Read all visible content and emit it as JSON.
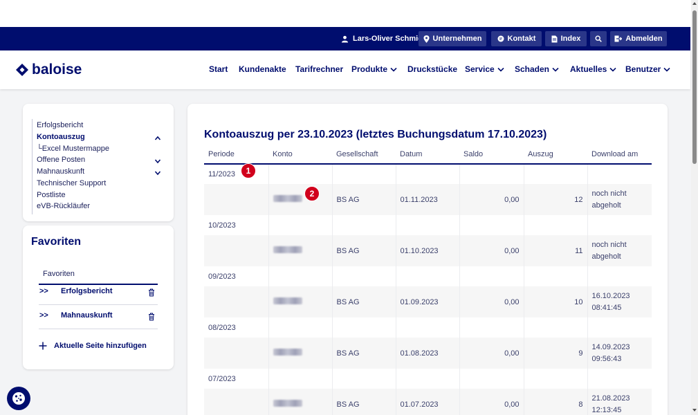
{
  "topbar": {
    "user": "Lars-Oliver Schmidt",
    "buttons": [
      {
        "label": "Unternehmen",
        "icon": "location-pin-icon"
      },
      {
        "label": "Kontakt",
        "icon": "chat-icon"
      },
      {
        "label": "Index",
        "icon": "document-icon"
      },
      {
        "label": "",
        "icon": "search-icon"
      },
      {
        "label": "Abmelden",
        "icon": "logout-icon"
      }
    ]
  },
  "header": {
    "logo": "baloise",
    "nav": [
      {
        "label": "Start",
        "dropdown": false
      },
      {
        "label": "Kundenakte",
        "dropdown": false
      },
      {
        "label": "Tarifrechner",
        "dropdown": false
      },
      {
        "label": "Produkte",
        "dropdown": true
      },
      {
        "label": "Druckstücke",
        "dropdown": false
      },
      {
        "label": "Service",
        "dropdown": true
      },
      {
        "label": "Schaden",
        "dropdown": true
      },
      {
        "label": "Aktuelles",
        "dropdown": true
      },
      {
        "label": "Benutzer",
        "dropdown": true
      }
    ]
  },
  "sidebar": {
    "items": [
      {
        "label": "Erfolgsbericht"
      },
      {
        "label": "Kontoauszug",
        "active": true,
        "chevron": "up"
      },
      {
        "label": "└Excel Mustermappe",
        "sub": true
      },
      {
        "label": "Offene Posten",
        "chevron": "down"
      },
      {
        "label": "Mahnauskunft",
        "chevron": "down"
      },
      {
        "label": "Technischer Support"
      },
      {
        "label": "Postliste"
      },
      {
        "label": "eVB-Rückläufer"
      }
    ]
  },
  "favorites": {
    "title": "Favoriten",
    "subtitle": "Favoriten",
    "items": [
      {
        "label": "Erfolgsbericht"
      },
      {
        "label": "Mahnauskunft"
      }
    ],
    "add_label": "Aktuelle Seite hinzufügen"
  },
  "main": {
    "title": "Kontoauszug per 23.10.2023 (letztes Buchungsdatum 17.10.2023)",
    "columns": [
      "Periode",
      "Konto",
      "Gesellschaft",
      "Datum",
      "Saldo",
      "Auszug",
      "Download am"
    ],
    "groups": [
      {
        "period": "11/2023",
        "gesellschaft": "BS AG",
        "datum": "01.11.2023",
        "saldo": "0,00",
        "auszug": "12",
        "download_line1": "noch nicht",
        "download_line2": "abgeholt"
      },
      {
        "period": "10/2023",
        "gesellschaft": "BS AG",
        "datum": "01.10.2023",
        "saldo": "0,00",
        "auszug": "11",
        "download_line1": "noch nicht",
        "download_line2": "abgeholt"
      },
      {
        "period": "09/2023",
        "gesellschaft": "BS AG",
        "datum": "01.09.2023",
        "saldo": "0,00",
        "auszug": "10",
        "download_line1": "16.10.2023",
        "download_line2": "08:41:45"
      },
      {
        "period": "08/2023",
        "gesellschaft": "BS AG",
        "datum": "01.08.2023",
        "saldo": "0,00",
        "auszug": "9",
        "download_line1": "14.09.2023",
        "download_line2": "09:56:43"
      },
      {
        "period": "07/2023",
        "gesellschaft": "BS AG",
        "datum": "01.07.2023",
        "saldo": "0,00",
        "auszug": "8",
        "download_line1": "21.08.2023",
        "download_line2": "12:13:45"
      }
    ]
  },
  "annotations": [
    {
      "label": "1"
    },
    {
      "label": "2"
    }
  ],
  "colors": {
    "brand_navy": "#000d6e",
    "badge_red": "#d1001c"
  }
}
